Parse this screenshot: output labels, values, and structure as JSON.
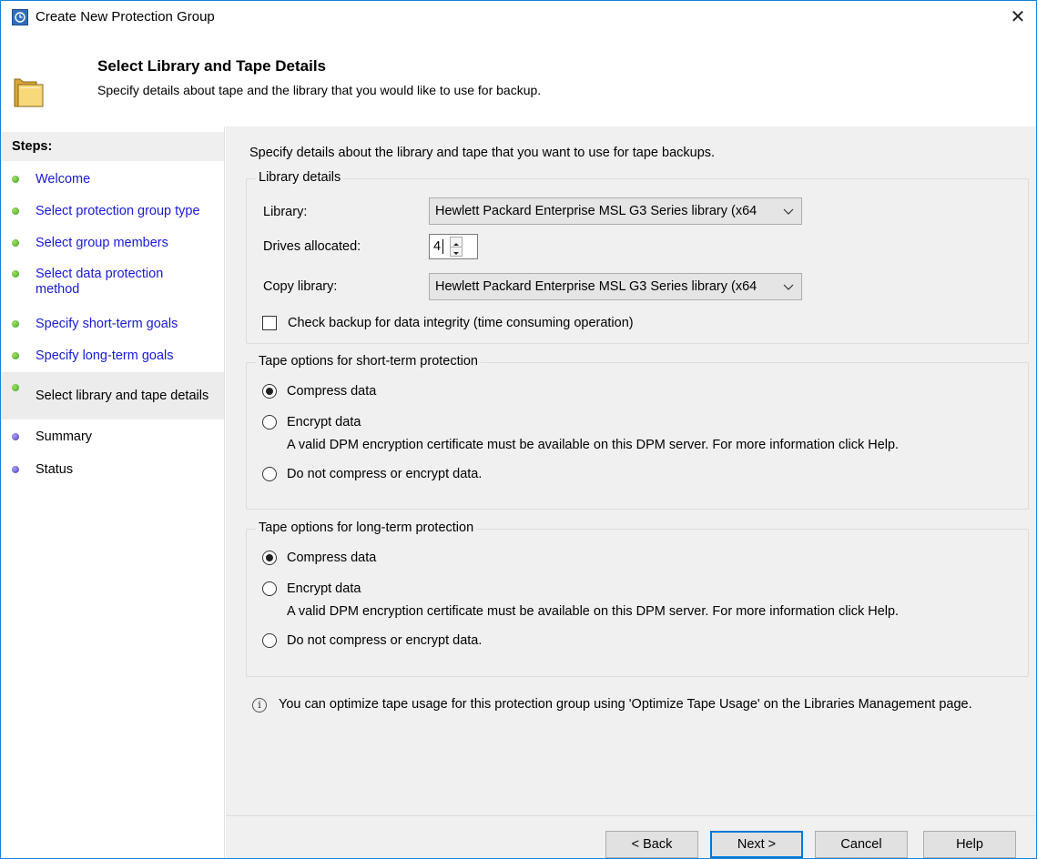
{
  "window": {
    "title": "Create New Protection Group",
    "close_glyph": "✕"
  },
  "header": {
    "title": "Select Library and Tape Details",
    "subtitle": "Specify details about tape and the library that you would like to use for backup."
  },
  "steps": {
    "heading": "Steps:",
    "items": [
      {
        "label": "Welcome",
        "state": "done",
        "link": true
      },
      {
        "label": "Select protection group type",
        "state": "done",
        "link": true
      },
      {
        "label": "Select group members",
        "state": "done",
        "link": true
      },
      {
        "label": "Select data protection method",
        "state": "done",
        "link": true
      },
      {
        "label": "Specify short-term goals",
        "state": "done",
        "link": true
      },
      {
        "label": "Specify long-term goals",
        "state": "done",
        "link": true
      },
      {
        "label": "Select library and tape details",
        "state": "current",
        "link": false
      },
      {
        "label": "Summary",
        "state": "pending",
        "link": false
      },
      {
        "label": "Status",
        "state": "pending",
        "link": false
      }
    ]
  },
  "content": {
    "intro": "Specify details about the library and tape that you want to use for tape backups.",
    "library_details": {
      "legend": "Library details",
      "library_label": "Library:",
      "library_value": "Hewlett Packard Enterprise MSL G3 Series library  (x64",
      "drives_label": "Drives allocated:",
      "drives_value": "4",
      "copy_library_label": "Copy library:",
      "copy_library_value": "Hewlett Packard Enterprise MSL G3 Series library  (x64",
      "check_backup_label": "Check backup for data integrity (time consuming operation)",
      "check_backup_checked": false
    },
    "short_term": {
      "legend": "Tape options for short-term protection",
      "compress_label": "Compress data",
      "encrypt_label": "Encrypt data",
      "encrypt_note": "A valid DPM encryption certificate must be available on this DPM server. For more information click Help.",
      "none_label": "Do not compress or encrypt data.",
      "selected": "compress"
    },
    "long_term": {
      "legend": "Tape options for long-term protection",
      "compress_label": "Compress data",
      "encrypt_label": "Encrypt data",
      "encrypt_note": "A valid DPM encryption certificate must be available on this DPM server. For more information click Help.",
      "none_label": "Do not compress or encrypt data.",
      "selected": "compress"
    },
    "info_text": "You can optimize tape usage for this protection group using 'Optimize Tape Usage' on the Libraries Management page.",
    "info_glyph": "i"
  },
  "buttons": {
    "back": "< Back",
    "next": "Next >",
    "cancel": "Cancel",
    "help": "Help"
  },
  "colors": {
    "accent": "#0078d7",
    "link": "#1a1ad8",
    "done_dot": "#3aa32a",
    "pending_dot": "#4a3fc0"
  }
}
